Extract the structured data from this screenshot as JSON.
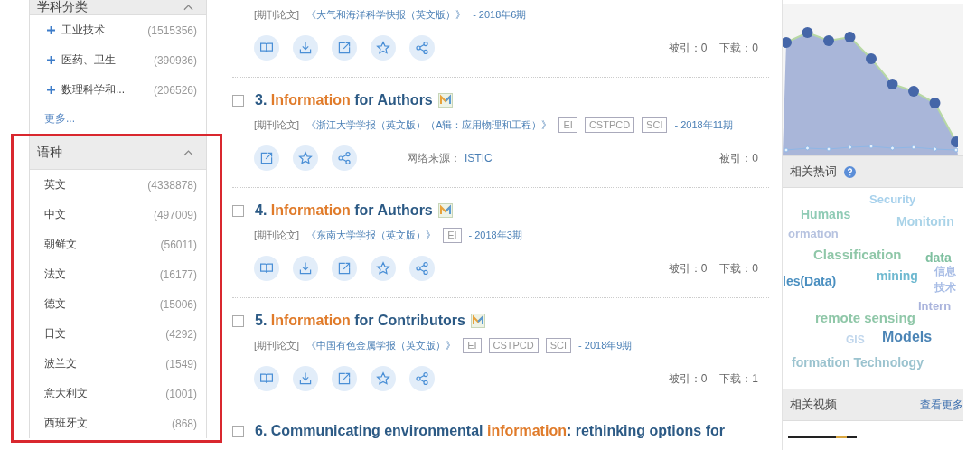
{
  "sidebar": {
    "facets": [
      {
        "title": "学科分类",
        "collapsed": false,
        "highlighted": false,
        "items": [
          {
            "label": "工业技术",
            "count": "(1515356)",
            "expanded": false
          },
          {
            "label": "医药、卫生",
            "count": "(390936)",
            "expanded": false
          },
          {
            "label": "数理科学和...",
            "count": "(206526)",
            "expanded": false
          }
        ],
        "more": "更多..."
      },
      {
        "title": "语种",
        "collapsed": false,
        "highlighted": true,
        "items": [
          {
            "label": "英文",
            "count": "(4338878)"
          },
          {
            "label": "中文",
            "count": "(497009)"
          },
          {
            "label": "朝鲜文",
            "count": "(56011)"
          },
          {
            "label": "法文",
            "count": "(16177)"
          },
          {
            "label": "德文",
            "count": "(15006)"
          },
          {
            "label": "日文",
            "count": "(4292)"
          },
          {
            "label": "波兰文",
            "count": "(1549)"
          },
          {
            "label": "意大利文",
            "count": "(1001)"
          },
          {
            "label": "西班牙文",
            "count": "(868)"
          }
        ]
      }
    ]
  },
  "results": [
    {
      "meta": {
        "type": "[期刊论文]",
        "journal": "《大气和海洋科学快报（英文版）》",
        "issue": "- 2018年6期"
      },
      "actions": [
        {
          "kind": "read"
        },
        {
          "kind": "download"
        },
        {
          "kind": "open"
        },
        {
          "kind": "favorite"
        },
        {
          "kind": "share"
        }
      ],
      "stats": [
        "被引：0",
        "下载：0"
      ]
    },
    {
      "checked": false,
      "title": [
        {
          "text": "3. ",
          "hit": false
        },
        {
          "text": "Information",
          "hit": true
        },
        {
          "text": " for Authors",
          "hit": false
        }
      ],
      "m_badge": true,
      "meta": {
        "type": "[期刊论文]",
        "journal": "《浙江大学学报（英文版）（A辑：应用物理和工程）》",
        "tags": [
          "EI",
          "CSTPCD",
          "SCI"
        ],
        "issue": "- 2018年11期"
      },
      "actions": [
        {
          "kind": "open"
        },
        {
          "kind": "favorite"
        },
        {
          "kind": "share"
        }
      ],
      "source": {
        "label": "网络来源：",
        "value": "ISTIC"
      },
      "stats": [
        "被引：0"
      ]
    },
    {
      "checked": false,
      "title": [
        {
          "text": "4. ",
          "hit": false
        },
        {
          "text": "Information",
          "hit": true
        },
        {
          "text": " for Authors",
          "hit": false
        }
      ],
      "m_badge": true,
      "meta": {
        "type": "[期刊论文]",
        "journal": "《东南大学学报（英文版）》",
        "tags": [
          "EI"
        ],
        "issue": "- 2018年3期"
      },
      "actions": [
        {
          "kind": "read"
        },
        {
          "kind": "download"
        },
        {
          "kind": "open"
        },
        {
          "kind": "favorite"
        },
        {
          "kind": "share"
        }
      ],
      "stats": [
        "被引：0",
        "下载：0"
      ]
    },
    {
      "checked": false,
      "title": [
        {
          "text": "5. ",
          "hit": false
        },
        {
          "text": "Information",
          "hit": true
        },
        {
          "text": " for Contributors",
          "hit": false
        }
      ],
      "m_badge": true,
      "meta": {
        "type": "[期刊论文]",
        "journal": "《中国有色金属学报（英文版）》",
        "tags": [
          "EI",
          "CSTPCD",
          "SCI"
        ],
        "issue": "- 2018年9期"
      },
      "actions": [
        {
          "kind": "read"
        },
        {
          "kind": "download"
        },
        {
          "kind": "open"
        },
        {
          "kind": "favorite"
        },
        {
          "kind": "share"
        }
      ],
      "stats": [
        "被引：0",
        "下载：1"
      ]
    },
    {
      "checked": false,
      "title": [
        {
          "text": "6. Communicating environmental ",
          "hit": false
        },
        {
          "text": "information",
          "hit": true
        },
        {
          "text": ": rethinking options for",
          "hit": false
        }
      ],
      "m_badge": false
    }
  ],
  "right_panel": {
    "hot_words": {
      "title": "相关热词",
      "words": [
        {
          "text": "Humans",
          "color": "#8fcbb5"
        },
        {
          "text": "Security",
          "color": "#a7d1ec"
        },
        {
          "text": "Monitorin",
          "color": "#a9d3e8"
        },
        {
          "text": "ormation",
          "color": "#b7c3e0"
        },
        {
          "text": "Classification",
          "color": "#8fc7a8"
        },
        {
          "text": "data",
          "color": "#7fc0a0"
        },
        {
          "text": "les(Data)",
          "color": "#4a8fc0"
        },
        {
          "text": "mining",
          "color": "#6fb9d0"
        },
        {
          "text": "信息",
          "color": "#a8bde6"
        },
        {
          "text": "技术",
          "color": "#a8bde6"
        },
        {
          "text": "Intern",
          "color": "#a9b3dc"
        },
        {
          "text": "remote sensing",
          "color": "#8fc7a8"
        },
        {
          "text": "Models",
          "color": "#4b84b5"
        },
        {
          "text": "GIS",
          "color": "#c0d6ec"
        },
        {
          "text": "formation Technology",
          "color": "#9bc3cf"
        }
      ]
    },
    "videos": {
      "title": "相关视频",
      "more": "查看更多"
    }
  }
}
